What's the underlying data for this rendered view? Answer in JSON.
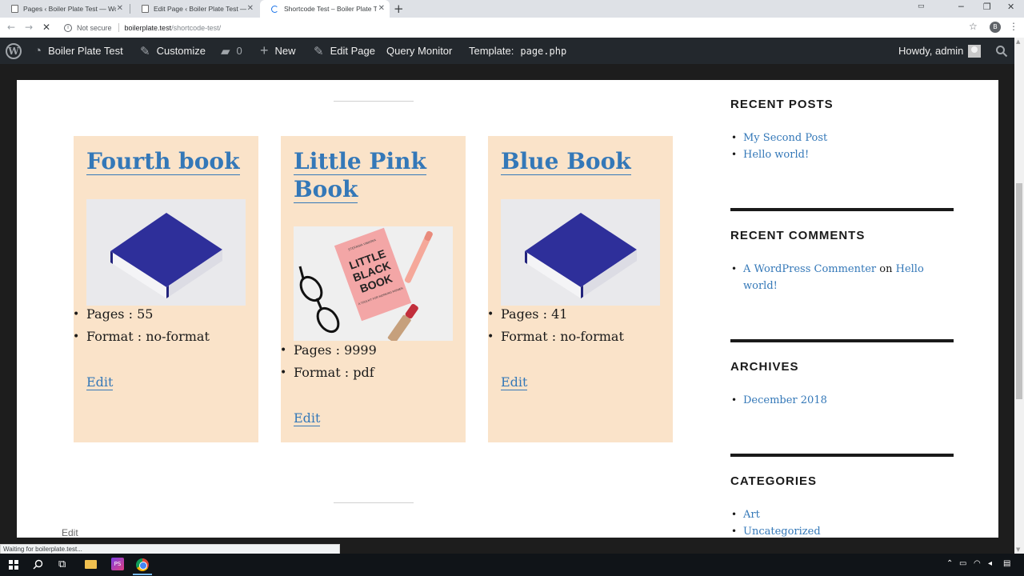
{
  "browser": {
    "tabs": [
      {
        "title": "Pages ‹ Boiler Plate Test — WordPress"
      },
      {
        "title": "Edit Page ‹ Boiler Plate Test — WordPress"
      },
      {
        "title": "Shortcode Test – Boiler Plate Test"
      }
    ],
    "new_tab": "+",
    "window_controls": {
      "minimize": "─",
      "maximize": "❐",
      "close": "✕"
    },
    "address": {
      "security_label": "Not secure",
      "host": "boilerplate.test",
      "path": "/shortcode-test/"
    },
    "profile_initial": "B",
    "status_text": "Waiting for boilerplate.test..."
  },
  "adminbar": {
    "site_name": "Boiler Plate Test",
    "customize": "Customize",
    "comments_count": "0",
    "new": "New",
    "edit_page": "Edit Page",
    "query_monitor": "Query Monitor",
    "template_label": "Template:",
    "template_file": "page.php",
    "howdy": "Howdy, admin",
    "icons": {
      "wp": "wordpress-logo-icon",
      "dashboard": "dashboard-icon",
      "customize": "brush-icon",
      "comments": "comment-icon",
      "new": "plus-icon",
      "edit": "pencil-icon",
      "search": "search-icon"
    }
  },
  "books": [
    {
      "title": "Fourth book",
      "pages": "Pages : 55",
      "format": "Format : no-format",
      "edit": "Edit",
      "image": "blue-book"
    },
    {
      "title": "Little Pink Book",
      "pages": "Pages : 9999",
      "format": "Format : pdf",
      "edit": "Edit",
      "image": "little-black-book",
      "cover_text": {
        "author": "STEFANIA VIMARIA",
        "line1": "LITTLE",
        "line2": "BLACK",
        "line3": "BOOK",
        "subtitle": "A TOOLKIT FOR WORKING WOMEN"
      }
    },
    {
      "title": "Blue Book",
      "pages": "Pages : 41",
      "format": "Format : no-format",
      "edit": "Edit",
      "image": "blue-book"
    }
  ],
  "page_footer": {
    "edit": "Edit"
  },
  "sidebar": {
    "recent_posts": {
      "title": "RECENT POSTS",
      "items": [
        "My Second Post",
        "Hello world!"
      ]
    },
    "recent_comments": {
      "title": "RECENT COMMENTS",
      "author": "A WordPress Commenter",
      "on": "on",
      "post_line1": "Hello",
      "post_line2": "world!"
    },
    "archives": {
      "title": "ARCHIVES",
      "items": [
        "December 2018"
      ]
    },
    "categories": {
      "title": "CATEGORIES",
      "items": [
        "Art",
        "Uncategorized"
      ]
    }
  },
  "colors": {
    "link": "#3478b8",
    "card_bg": "#fae3c9",
    "adminbar_bg": "#23282d",
    "book_blue": "#2e2f9a"
  }
}
